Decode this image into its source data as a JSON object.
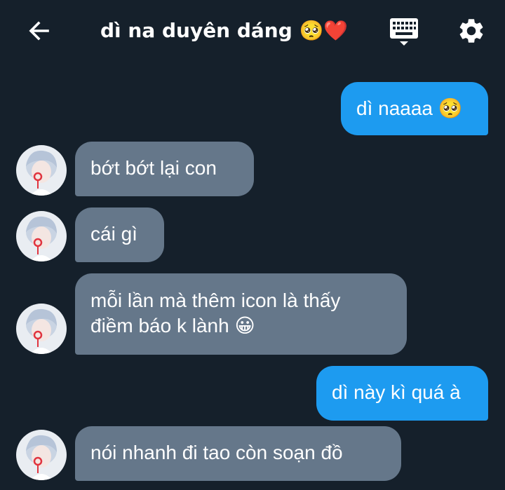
{
  "header": {
    "title": "dì na duyên dáng 🥺❤️",
    "back_icon": "arrow-left-icon",
    "keyboard_icon": "keyboard-icon",
    "settings_icon": "gear-icon"
  },
  "colors": {
    "background": "#15202b",
    "sent_bubble": "#1d9bf0",
    "received_bubble": "#65778a",
    "text": "#ffffff"
  },
  "messages": [
    {
      "sender": "me",
      "lines": [
        "dì naaaa 🥺"
      ]
    },
    {
      "sender": "other",
      "lines": [
        "bớt bớt lại con"
      ]
    },
    {
      "sender": "other",
      "lines": [
        "cái gì"
      ]
    },
    {
      "sender": "other",
      "lines": [
        "mỗi lần mà thêm icon là thấy",
        "điềm báo k lành 😀"
      ]
    },
    {
      "sender": "me",
      "lines": [
        "dì này kì quá à"
      ]
    },
    {
      "sender": "other",
      "lines": [
        "nói nhanh đi tao còn soạn đồ"
      ]
    }
  ]
}
